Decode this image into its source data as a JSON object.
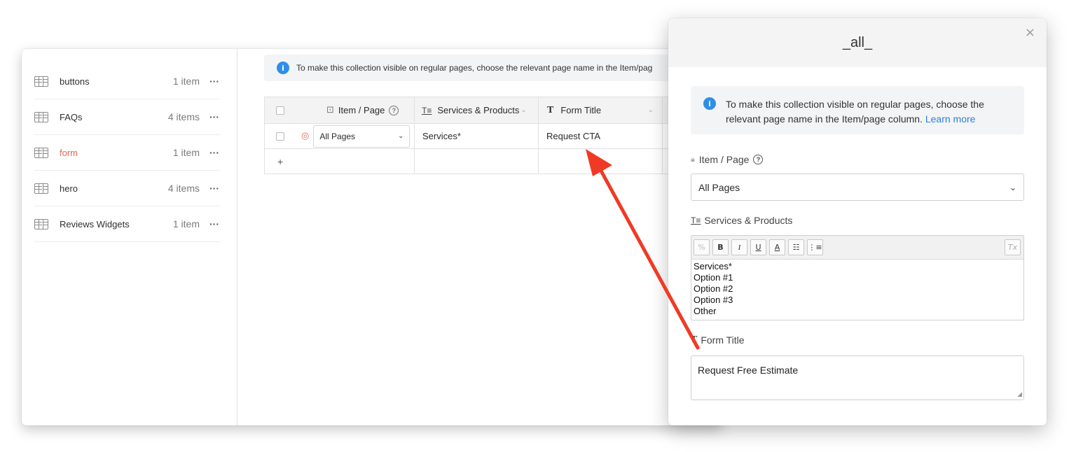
{
  "sidebar": {
    "items": [
      {
        "name": "buttons",
        "count": "1 item",
        "more": "···"
      },
      {
        "name": "FAQs",
        "count": "4 items",
        "more": "···"
      },
      {
        "name": "form",
        "count": "1 item",
        "more": "···"
      },
      {
        "name": "hero",
        "count": "4 items",
        "more": "···"
      },
      {
        "name": "Reviews Widgets",
        "count": "1 item",
        "more": "···"
      }
    ]
  },
  "main": {
    "info_text": "To make this collection visible on regular pages, choose the relevant page name in the Item/pag",
    "columns": [
      {
        "label": "Item / Page"
      },
      {
        "label": "Services & Products"
      },
      {
        "label": "Form Title"
      }
    ],
    "row": {
      "page": "All Pages",
      "services": "Services*",
      "form_title": "Request CTA"
    },
    "add_row": "+"
  },
  "modal": {
    "title": "_all_",
    "close": "×",
    "info_text": "To make this collection visible on regular pages, choose the relevant page name in the Item/page column.",
    "info_link": "Learn more",
    "item_page_label": "Item / Page",
    "item_page_value": "All Pages",
    "services_label": "Services & Products",
    "services_lines": [
      "Services*",
      "Option #1",
      "Option #2",
      "Option #3",
      "Other"
    ],
    "form_title_label": "Form Title",
    "form_title_value": "Request Free Estimate"
  },
  "colors": {
    "accent_orange": "#e06a4e",
    "info_blue": "#2f8fe6",
    "arrow_red": "#f03a25"
  }
}
